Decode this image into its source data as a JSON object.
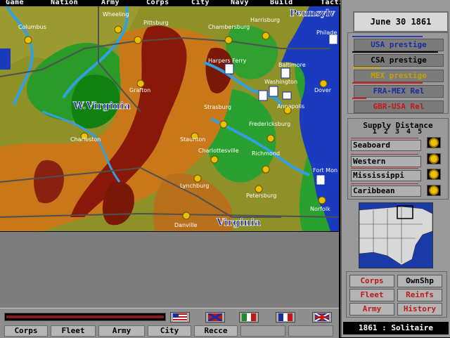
{
  "menu": [
    "Game",
    "Nation",
    "Army",
    "Corps",
    "City",
    "Navy",
    "Build",
    "Tactical"
  ],
  "map": {
    "cities": [
      {
        "name": "Columbus"
      },
      {
        "name": "Wheeling"
      },
      {
        "name": "Pittsburg"
      },
      {
        "name": "Chambersburg"
      },
      {
        "name": "Harrisburg"
      },
      {
        "name": "Philade"
      },
      {
        "name": "Harpers Ferry"
      },
      {
        "name": "Baltimore"
      },
      {
        "name": "Washington"
      },
      {
        "name": "Annapolis"
      },
      {
        "name": "Dover"
      },
      {
        "name": "Grafton"
      },
      {
        "name": "Strasburg"
      },
      {
        "name": "Fredericksburg"
      },
      {
        "name": "Charleston"
      },
      {
        "name": "Staunton"
      },
      {
        "name": "Charlottesville"
      },
      {
        "name": "Richmond"
      },
      {
        "name": "Fort Mon"
      },
      {
        "name": "Lynchburg"
      },
      {
        "name": "Petersburg"
      },
      {
        "name": "Norfolk"
      },
      {
        "name": "Danville"
      }
    ],
    "states": {
      "wv": "W.Virginia",
      "va": "Virginia",
      "pa": "Pennsylv"
    }
  },
  "date": "June 30 1861",
  "relations": [
    {
      "label": "USA prestige",
      "color": "#1a2aa0",
      "bar": "#2a3ac0"
    },
    {
      "label": "CSA prestige",
      "color": "#000000",
      "bar": "#000000"
    },
    {
      "label": "MEX prestige",
      "color": "#c8a000",
      "bar": "#d0a000"
    },
    {
      "label": "FRA-MEX Rel",
      "color": "#1a2aa0",
      "bar": "#d02020"
    },
    {
      "label": "GBR-USA Rel",
      "color": "#c01818",
      "bar": "#d02020"
    }
  ],
  "supply": {
    "title": "Supply Distance",
    "nums": "1 2 3 4 5",
    "rows": [
      {
        "label": "Seaboard"
      },
      {
        "label": "Western"
      },
      {
        "label": "Mississippi"
      },
      {
        "label": "Caribbean"
      }
    ]
  },
  "buttons": {
    "corps": "Corps",
    "ownshp": "OwnShp",
    "fleet": "Fleet",
    "reinfs": "Reinfs",
    "army": "Army",
    "history": "History"
  },
  "footer": "1861 : Solitaire",
  "bottom": {
    "buttons": [
      "Corps",
      "Fleet",
      "Army",
      "City",
      "Recce"
    ]
  },
  "flags": [
    "USA",
    "CSA",
    "MEX",
    "FRA",
    "GBR"
  ]
}
